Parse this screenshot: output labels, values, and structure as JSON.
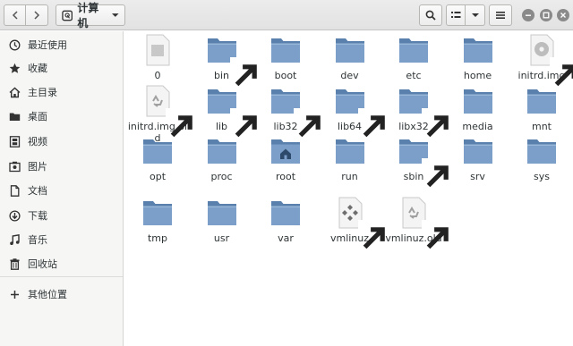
{
  "header": {
    "location_label": "计算机",
    "back_icon": "go-back-icon",
    "forward_icon": "go-forward-icon",
    "search_icon": "search-icon",
    "view_icon": "list-view-icon",
    "menu_icon": "hamburger-menu-icon"
  },
  "sidebar": {
    "items": [
      {
        "label": "最近使用",
        "icon": "recent-icon"
      },
      {
        "label": "收藏",
        "icon": "star-icon"
      },
      {
        "label": "主目录",
        "icon": "home-icon"
      },
      {
        "label": "桌面",
        "icon": "desktop-folder-icon"
      },
      {
        "label": "视频",
        "icon": "video-icon"
      },
      {
        "label": "图片",
        "icon": "picture-icon"
      },
      {
        "label": "文档",
        "icon": "document-icon"
      },
      {
        "label": "下载",
        "icon": "download-icon"
      },
      {
        "label": "音乐",
        "icon": "music-icon"
      },
      {
        "label": "回收站",
        "icon": "trash-icon"
      }
    ],
    "other_locations": {
      "label": "其他位置",
      "icon": "plus-icon"
    }
  },
  "files": [
    {
      "name": "0",
      "type": "blank-file",
      "link": false
    },
    {
      "name": "bin",
      "type": "folder",
      "link": true
    },
    {
      "name": "boot",
      "type": "folder",
      "link": false
    },
    {
      "name": "dev",
      "type": "folder",
      "link": false
    },
    {
      "name": "etc",
      "type": "folder",
      "link": false
    },
    {
      "name": "home",
      "type": "folder",
      "link": false
    },
    {
      "name": "initrd.img",
      "type": "disc-file",
      "link": true
    },
    {
      "name": "initrd.img.old",
      "type": "recycle-file",
      "link": true
    },
    {
      "name": "lib",
      "type": "folder",
      "link": true
    },
    {
      "name": "lib32",
      "type": "folder",
      "link": true
    },
    {
      "name": "lib64",
      "type": "folder",
      "link": true
    },
    {
      "name": "libx32",
      "type": "folder",
      "link": true
    },
    {
      "name": "media",
      "type": "folder",
      "link": false
    },
    {
      "name": "mnt",
      "type": "folder",
      "link": false
    },
    {
      "name": "opt",
      "type": "folder",
      "link": false
    },
    {
      "name": "proc",
      "type": "folder",
      "link": false
    },
    {
      "name": "root",
      "type": "home-folder",
      "link": false
    },
    {
      "name": "run",
      "type": "folder",
      "link": false
    },
    {
      "name": "sbin",
      "type": "folder",
      "link": true
    },
    {
      "name": "srv",
      "type": "folder",
      "link": false
    },
    {
      "name": "sys",
      "type": "folder",
      "link": false
    },
    {
      "name": "tmp",
      "type": "folder",
      "link": false
    },
    {
      "name": "usr",
      "type": "folder",
      "link": false
    },
    {
      "name": "var",
      "type": "folder",
      "link": false
    },
    {
      "name": "vmlinuz",
      "type": "exec-file",
      "link": true
    },
    {
      "name": "vmlinuz.old",
      "type": "recycle-file",
      "link": true
    }
  ],
  "colors": {
    "folder_body": "#7b9fc8",
    "folder_tab": "#5a80ad",
    "accent": "#4a79b0"
  }
}
